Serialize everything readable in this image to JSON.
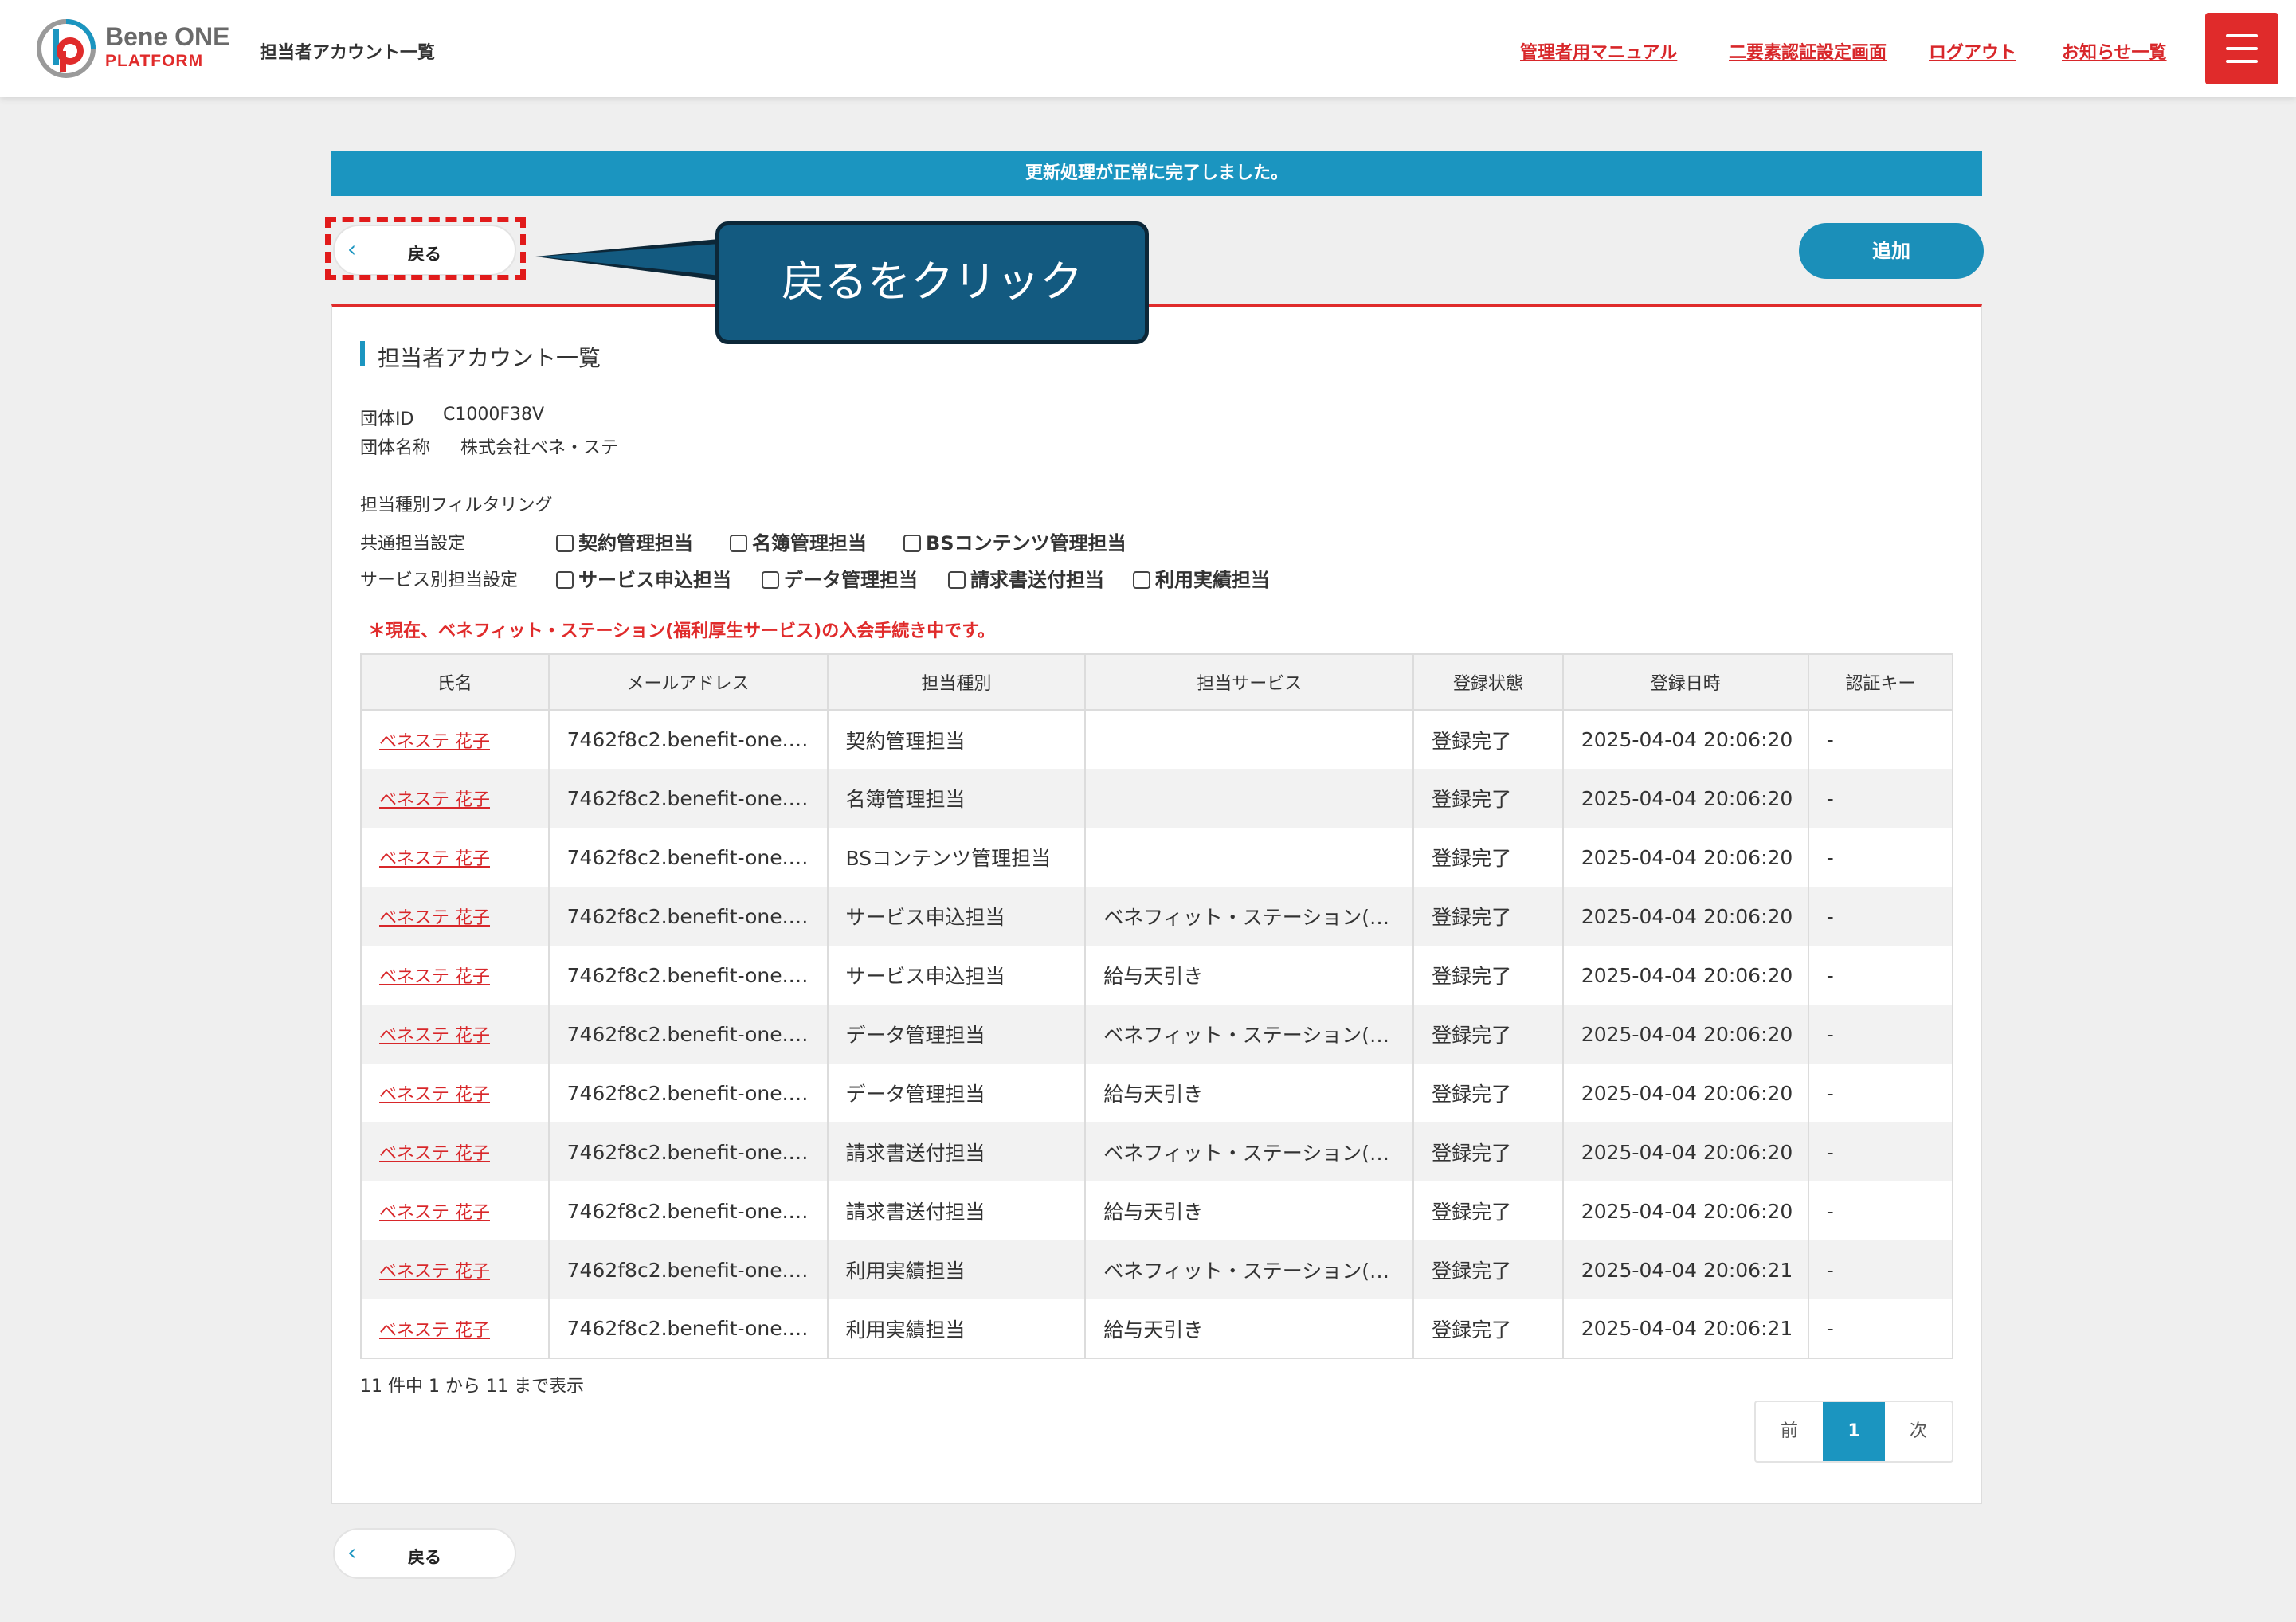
{
  "header": {
    "brand_top": "Bene ONE",
    "brand_bottom": "PLATFORM",
    "page_title": "担当者アカウント一覧",
    "nav": {
      "manual": "管理者用マニュアル",
      "two_factor": "二要素認証設定画面",
      "logout": "ログアウト",
      "notices": "お知らせ一覧"
    },
    "menu_icon": "hamburger-icon"
  },
  "banner": "更新処理が正常に完了しました。",
  "back_label": "戻る",
  "back_chevron": "‹",
  "callout": "戻るをクリック",
  "add_label": "追加",
  "section_title": "担当者アカウント一覧",
  "org": {
    "id_label": "団体ID",
    "id_value": "C1000F38V",
    "name_label": "団体名称",
    "name_value": "株式会社ベネ・ステ"
  },
  "filter": {
    "title": "担当種別フィルタリング",
    "common_label": "共通担当設定",
    "common_options": [
      "契約管理担当",
      "名簿管理担当",
      "BSコンテンツ管理担当"
    ],
    "service_label": "サービス別担当設定",
    "service_options": [
      "サービス申込担当",
      "データ管理担当",
      "請求書送付担当",
      "利用実績担当"
    ]
  },
  "notice": "＊現在、ベネフィット・ステーション(福利厚生サービス)の入会手続き中です。",
  "table": {
    "headers": [
      "氏名",
      "メールアドレス",
      "担当種別",
      "担当サービス",
      "登録状態",
      "登録日時",
      "認証キー"
    ],
    "rows": [
      [
        "ベネステ 花子",
        "7462f8c2.benefit-one.…",
        "契約管理担当",
        "",
        "登録完了",
        "2025-04-04 20:06:20",
        "-"
      ],
      [
        "ベネステ 花子",
        "7462f8c2.benefit-one.…",
        "名簿管理担当",
        "",
        "登録完了",
        "2025-04-04 20:06:20",
        "-"
      ],
      [
        "ベネステ 花子",
        "7462f8c2.benefit-one.…",
        "BSコンテンツ管理担当",
        "",
        "登録完了",
        "2025-04-04 20:06:20",
        "-"
      ],
      [
        "ベネステ 花子",
        "7462f8c2.benefit-one.…",
        "サービス申込担当",
        "ベネフィット・ステーション(…",
        "登録完了",
        "2025-04-04 20:06:20",
        "-"
      ],
      [
        "ベネステ 花子",
        "7462f8c2.benefit-one.…",
        "サービス申込担当",
        "給与天引き",
        "登録完了",
        "2025-04-04 20:06:20",
        "-"
      ],
      [
        "ベネステ 花子",
        "7462f8c2.benefit-one.…",
        "データ管理担当",
        "ベネフィット・ステーション(…",
        "登録完了",
        "2025-04-04 20:06:20",
        "-"
      ],
      [
        "ベネステ 花子",
        "7462f8c2.benefit-one.…",
        "データ管理担当",
        "給与天引き",
        "登録完了",
        "2025-04-04 20:06:20",
        "-"
      ],
      [
        "ベネステ 花子",
        "7462f8c2.benefit-one.…",
        "請求書送付担当",
        "ベネフィット・ステーション(…",
        "登録完了",
        "2025-04-04 20:06:20",
        "-"
      ],
      [
        "ベネステ 花子",
        "7462f8c2.benefit-one.…",
        "請求書送付担当",
        "給与天引き",
        "登録完了",
        "2025-04-04 20:06:20",
        "-"
      ],
      [
        "ベネステ 花子",
        "7462f8c2.benefit-one.…",
        "利用実績担当",
        "ベネフィット・ステーション(…",
        "登録完了",
        "2025-04-04 20:06:21",
        "-"
      ],
      [
        "ベネステ 花子",
        "7462f8c2.benefit-one.…",
        "利用実績担当",
        "給与天引き",
        "登録完了",
        "2025-04-04 20:06:21",
        "-"
      ]
    ]
  },
  "count_text": "11 件中 1 から 11 まで表示",
  "pager": {
    "prev": "前",
    "current": "1",
    "next": "次"
  },
  "colors": {
    "accent": "#1b95c0",
    "brand_red": "#e02b2b",
    "callout": "#135a80"
  }
}
